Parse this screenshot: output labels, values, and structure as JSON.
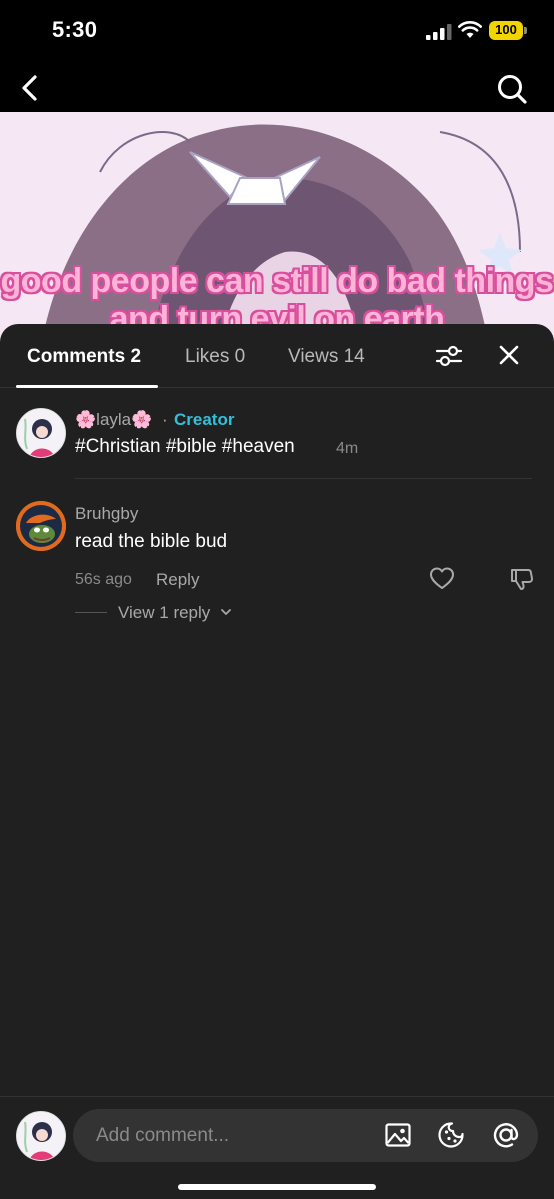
{
  "status_bar": {
    "time": "5:30",
    "battery": "100"
  },
  "video": {
    "caption": "good people can still do bad things and turn evil on earth"
  },
  "tabs": {
    "comments": "Comments 2",
    "likes": "Likes 0",
    "views": "Views 14"
  },
  "comments": [
    {
      "author": "🌸layla🌸",
      "separator": "·",
      "badge": "Creator",
      "text": "#Christian #bible #heaven",
      "time": "4m"
    },
    {
      "author": "Bruhgby",
      "text": "read the bible bud",
      "time": "56s ago",
      "reply_label": "Reply",
      "view_replies": "View 1 reply"
    }
  ],
  "composer": {
    "placeholder": "Add comment..."
  },
  "icons": {
    "back": "chevron-left-icon",
    "search": "search-icon",
    "filter": "sliders-icon",
    "close": "close-icon",
    "like": "heart-icon",
    "dislike": "thumbs-down-icon",
    "image": "image-icon",
    "sticker": "sticker-icon",
    "mention": "at-sign-icon"
  },
  "colors": {
    "sheet_bg": "#202020",
    "creator_accent": "#33bfd9",
    "caption_fill": "#ffb4d8",
    "caption_stroke": "#d84f9e"
  }
}
